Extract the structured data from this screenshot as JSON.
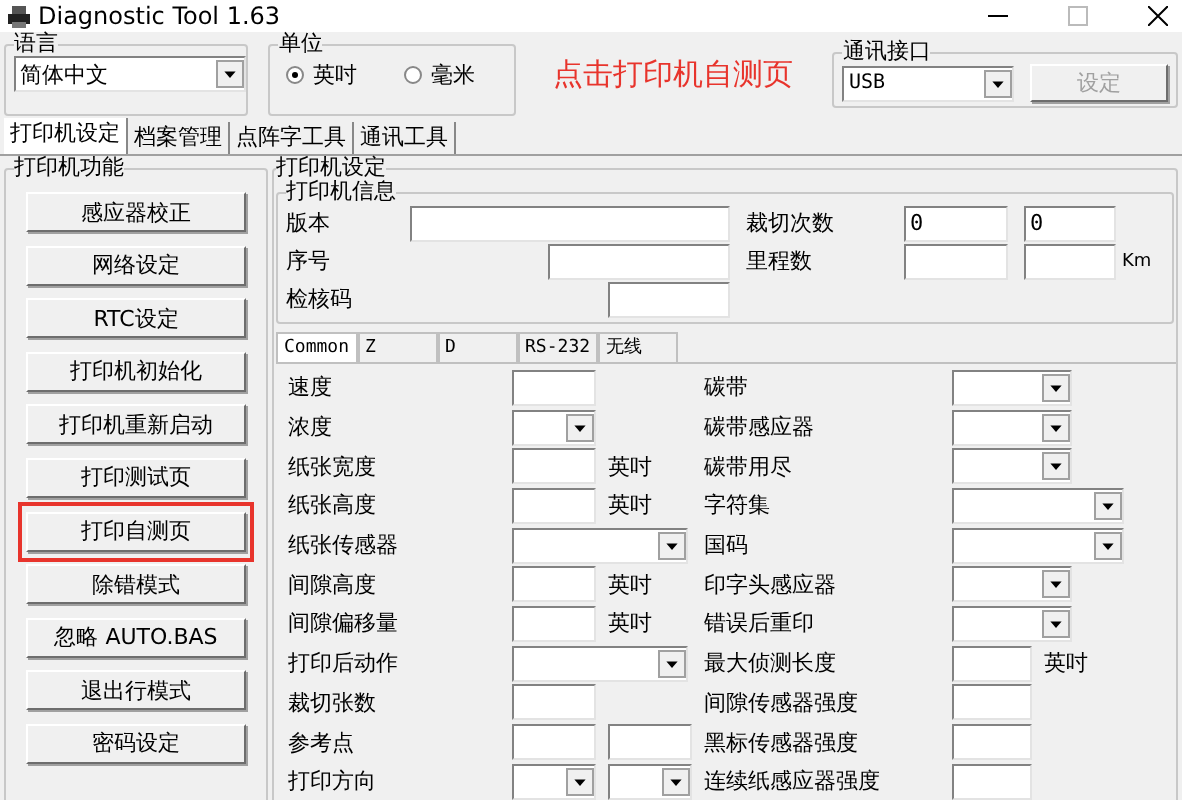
{
  "window": {
    "title": "Diagnostic Tool 1.63"
  },
  "language": {
    "legend": "语言",
    "value": "简体中文"
  },
  "unit": {
    "legend": "单位",
    "options": [
      {
        "label": "英吋",
        "selected": true
      },
      {
        "label": "毫米",
        "selected": false
      }
    ]
  },
  "port": {
    "legend": "通讯接口",
    "value": "USB",
    "button": {
      "label": "设定",
      "disabled": true
    }
  },
  "tabs": [
    {
      "label": "打印机设定",
      "selected": true
    },
    {
      "label": "档案管理",
      "selected": false
    },
    {
      "label": "点阵字工具",
      "selected": false
    },
    {
      "label": "通讯工具",
      "selected": false
    }
  ],
  "functions": {
    "legend": "打印机功能",
    "buttons": [
      {
        "label": "感应器校正",
        "highlighted": false
      },
      {
        "label": "网络设定",
        "highlighted": false
      },
      {
        "label": "RTC设定",
        "highlighted": false
      },
      {
        "label": "打印机初始化",
        "highlighted": false
      },
      {
        "label": "打印机重新启动",
        "highlighted": false
      },
      {
        "label": "打印测试页",
        "highlighted": false
      },
      {
        "label": "打印自测页",
        "highlighted": true
      },
      {
        "label": "除错模式",
        "highlighted": false
      },
      {
        "label": "忽略 AUTO.BAS",
        "highlighted": false
      },
      {
        "label": "退出行模式",
        "highlighted": false
      },
      {
        "label": "密码设定",
        "highlighted": false
      }
    ]
  },
  "settings": {
    "legend": "打印机设定",
    "info": {
      "legend": "打印机信息",
      "version_label": "版本",
      "serial_label": "序号",
      "checksum_label": "检核码",
      "cut_count_label": "裁切次数",
      "cut_count_values": [
        "0",
        "0"
      ],
      "mileage_label": "里程数",
      "mileage_unit": "Km"
    },
    "subtabs": [
      {
        "label": "Common",
        "selected": true
      },
      {
        "label": "Z",
        "selected": false
      },
      {
        "label": "D",
        "selected": false
      },
      {
        "label": "RS-232",
        "selected": false
      },
      {
        "label": "无线",
        "selected": false
      }
    ],
    "rows": [
      {
        "left": {
          "label": "速度",
          "kind": "field"
        },
        "right": {
          "label": "碳带",
          "kind": "select"
        }
      },
      {
        "left": {
          "label": "浓度",
          "kind": "select"
        },
        "right": {
          "label": "碳带感应器",
          "kind": "select"
        }
      },
      {
        "left": {
          "label": "纸张宽度",
          "kind": "field",
          "unit": "英吋"
        },
        "right": {
          "label": "碳带用尽",
          "kind": "select"
        }
      },
      {
        "left": {
          "label": "纸张高度",
          "kind": "field",
          "unit": "英吋"
        },
        "right": {
          "label": "字符集",
          "kind": "wide-select"
        }
      },
      {
        "left": {
          "label": "纸张传感器",
          "kind": "wide-select"
        },
        "right": {
          "label": "国码",
          "kind": "wide-select"
        }
      },
      {
        "left": {
          "label": "间隙高度",
          "kind": "field",
          "unit": "英吋"
        },
        "right": {
          "label": "印字头感应器",
          "kind": "select"
        }
      },
      {
        "left": {
          "label": "间隙偏移量",
          "kind": "field",
          "unit": "英吋"
        },
        "right": {
          "label": "错误后重印",
          "kind": "select"
        }
      },
      {
        "left": {
          "label": "打印后动作",
          "kind": "wide-select"
        },
        "right": {
          "label": "最大侦测长度",
          "kind": "field",
          "unit": "英吋"
        }
      },
      {
        "left": {
          "label": "裁切张数",
          "kind": "field"
        },
        "right": {
          "label": "间隙传感器强度",
          "kind": "field"
        }
      },
      {
        "left": {
          "label": "参考点",
          "kind": "two-fields"
        },
        "right": {
          "label": "黑标传感器强度",
          "kind": "field"
        }
      },
      {
        "left": {
          "label": "打印方向",
          "kind": "two-selects"
        },
        "right": {
          "label": "连续纸感应器强度",
          "kind": "field"
        }
      }
    ]
  },
  "annotation": "点击打印机自测页"
}
